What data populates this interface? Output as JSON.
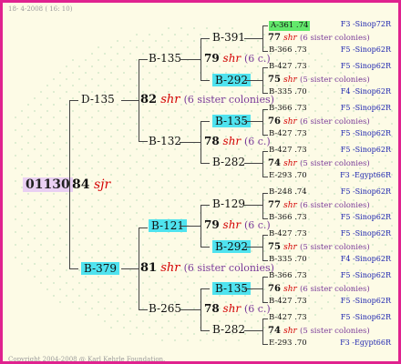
{
  "header": "18- 4-2008 ( 16: 10)",
  "footer": "Copyright 2004-2008 @ Karl Kehrle Foundation.",
  "colors": {
    "border": "#e0228f",
    "background": "#fdfbe6",
    "highlight_cyan": "#4fe3ef",
    "highlight_green": "#62e86b",
    "highlight_pink": "#ead0f3",
    "red": "#d40000",
    "purple": "#7a3a99",
    "blue": "#2027b0"
  },
  "root": {
    "id": "01130",
    "num": "84",
    "race": "sjr"
  },
  "gen1": [
    {
      "id": "D-135",
      "num": "82",
      "race": "shr",
      "note": "(6 sister colonies)"
    },
    {
      "id": "B-379",
      "num": "81",
      "race": "shr",
      "note": "(6 sister colonies)"
    }
  ],
  "gen2": [
    "B-135",
    "B-132",
    "B-121",
    "B-265"
  ],
  "gen3": [
    {
      "sire": "B-391",
      "num": "79",
      "race": "shr",
      "note": "(6 c.)",
      "dam": "B-292"
    },
    {
      "sire": "B-135",
      "num": "78",
      "race": "shr",
      "note": "(6 c.)",
      "dam": "B-282"
    },
    {
      "sire": "B-129",
      "num": "79",
      "race": "shr",
      "note": "(6 c.)",
      "dam": "B-292"
    },
    {
      "sire": "B-135",
      "num": "78",
      "race": "shr",
      "note": "(6 c.)",
      "dam": "B-282"
    }
  ],
  "gen4": [
    {
      "top": "A-361 .74",
      "num": "77",
      "race": "shr",
      "note": "(6 sister colonies)",
      "bot": "B-366 .73",
      "loc1": "F3 -Sinop72R",
      "loc2": "F5 -Sinop62R"
    },
    {
      "top": "B-427 .73",
      "num": "75",
      "race": "shr",
      "note": "(5 sister colonies)",
      "bot": "B-335 .70",
      "loc1": "F5 -Sinop62R",
      "loc2": "F4 -Sinop62R"
    },
    {
      "top": "B-366 .73",
      "num": "76",
      "race": "shr",
      "note": "(6 sister colonies)",
      "bot": "B-427 .73",
      "loc1": "F5 -Sinop62R",
      "loc2": "F5 -Sinop62R"
    },
    {
      "top": "B-427 .73",
      "num": "74",
      "race": "shr",
      "note": "(5 sister colonies)",
      "bot": "E-293 .70",
      "loc1": "F5 -Sinop62R",
      "loc2": "F3 -Egypt66R"
    },
    {
      "top": "B-248 .74",
      "num": "77",
      "race": "shr",
      "note": "(6 sister colonies)",
      "bot": "B-366 .73",
      "loc1": "F5 -Sinop62R",
      "loc2": "F5 -Sinop62R"
    },
    {
      "top": "B-427 .73",
      "num": "75",
      "race": "shr",
      "note": "(5 sister colonies)",
      "bot": "B-335 .70",
      "loc1": "F5 -Sinop62R",
      "loc2": "F4 -Sinop62R"
    },
    {
      "top": "B-366 .73",
      "num": "76",
      "race": "shr",
      "note": "(6 sister colonies)",
      "bot": "B-427 .73",
      "loc1": "F5 -Sinop62R",
      "loc2": "F5 -Sinop62R"
    },
    {
      "top": "B-427 .73",
      "num": "74",
      "race": "shr",
      "note": "(5 sister colonies)",
      "bot": "E-293 .70",
      "loc1": "F5 -Sinop62R",
      "loc2": "F3 -Egypt66R"
    }
  ]
}
